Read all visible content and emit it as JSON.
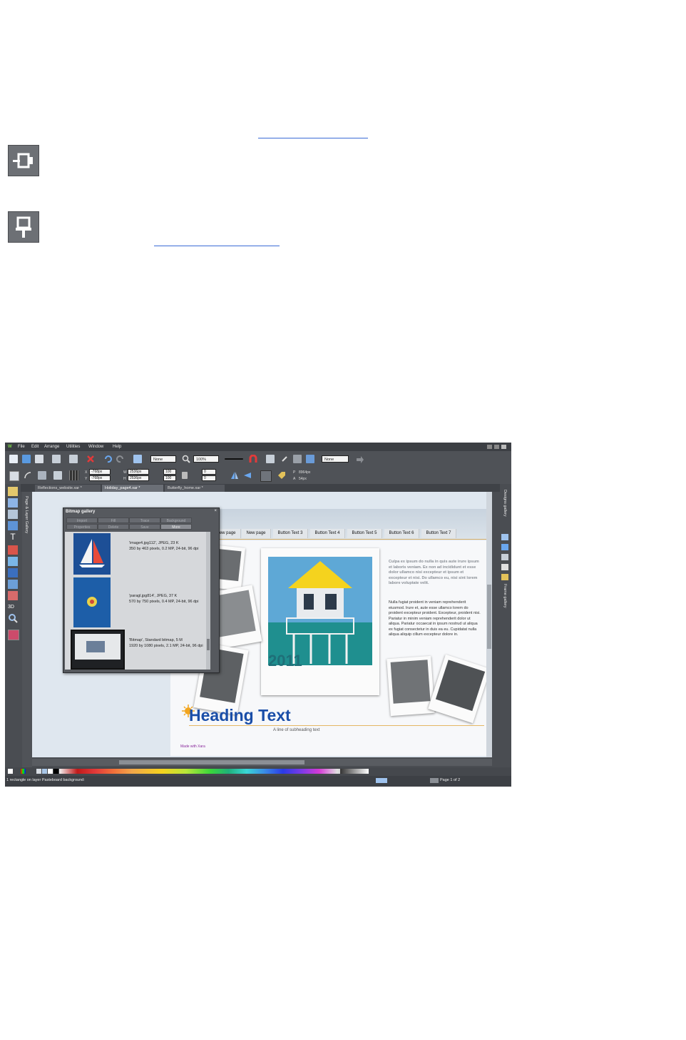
{
  "app": {
    "logo": "W",
    "menu": [
      "File",
      "Edit",
      "Arrange",
      "Utilities",
      "Window",
      "Help"
    ],
    "toolbar1": {
      "fill_select": "None",
      "zoom_select": "100%",
      "feather_select": "None"
    },
    "toolbar2": {
      "x_label": "X",
      "y_label": "Y",
      "w_label": "W",
      "h_label": "H",
      "x_value": "-768px",
      "y_value": "-768px",
      "w_value": "2536px",
      "h_value": "2536px",
      "scale_x": "100",
      "scale_y": "100",
      "angle": "0",
      "shear": "0",
      "p_label": "P",
      "a_label": "A",
      "p_value": "8964px",
      "a_value": "54px"
    },
    "tabs": [
      "Reflections_website.xar *",
      "Holiday_page4.xar *",
      "Butterfly_home.xar *"
    ],
    "left_panel_label": "Page & Layer Gallery",
    "right_panels": [
      "Designs gallery",
      "Frame gallery"
    ],
    "status_left": "1 rectangle on layer Pasteboard background:",
    "status_right": "Page 1 of 2"
  },
  "gallery": {
    "title": "Bitmap gallery",
    "buttons_row1": [
      "Import",
      "Fill",
      "Trace",
      "Background"
    ],
    "buttons_row2": [
      "Properties",
      "Delete",
      "Save",
      "More"
    ],
    "items": [
      {
        "name": "'image4.jpg112', JPEG, 23 K",
        "details": "350 by 463 pixels, 0.2 MP, 24-bit, 96 dpi"
      },
      {
        "name": "'paragl.jpg814', JPEG, 37 K",
        "details": "570 by 750 pixels, 0.4 MP, 24-bit, 96 dpi"
      },
      {
        "name": "'Bitmap', Standard bitmap, 5 M",
        "details": "1920 by 1080 pixels, 2.1 MP, 24-bit, 96 dpi"
      }
    ]
  },
  "webpage": {
    "nav": [
      "New page",
      "New page",
      "Button Text 3",
      "Button Text 4",
      "Button Text 5",
      "Button Text 6",
      "Button Text 7"
    ],
    "year": "2011",
    "heading": "Heading Text",
    "subheading": "A line of subheading text",
    "made_with": "Made with Xara",
    "para1": "Culpa ex ipsum do nulla in quis aute irure ipsum et laboris veniam. Ex non ad incididunt et esse dolor ullamco nisi excepteur et ipsum et excepteur et nisi. Do ullamco eu, nisi sint lorem labore voluptate velit.",
    "para2": "Nulla fugiat proident in veniam reprehenderit eiusmod. Irure et, aute esse ullamco lorem do proident excepteur proident. Excepteur, proident nisi. Pariatur in minim veniam reprehenderit dolor ut aliqua. Pariatur occaecat in ipsum nostrud ut aliqua ex fugiat consectetur in duis ea eu. Cupidatat nulla aliqua aliquip cillum excepteur dolore in."
  },
  "colors": {
    "accent_heading": "#1a4ea8",
    "year_teal": "#1f6f78",
    "link": "#3a6bd6"
  }
}
